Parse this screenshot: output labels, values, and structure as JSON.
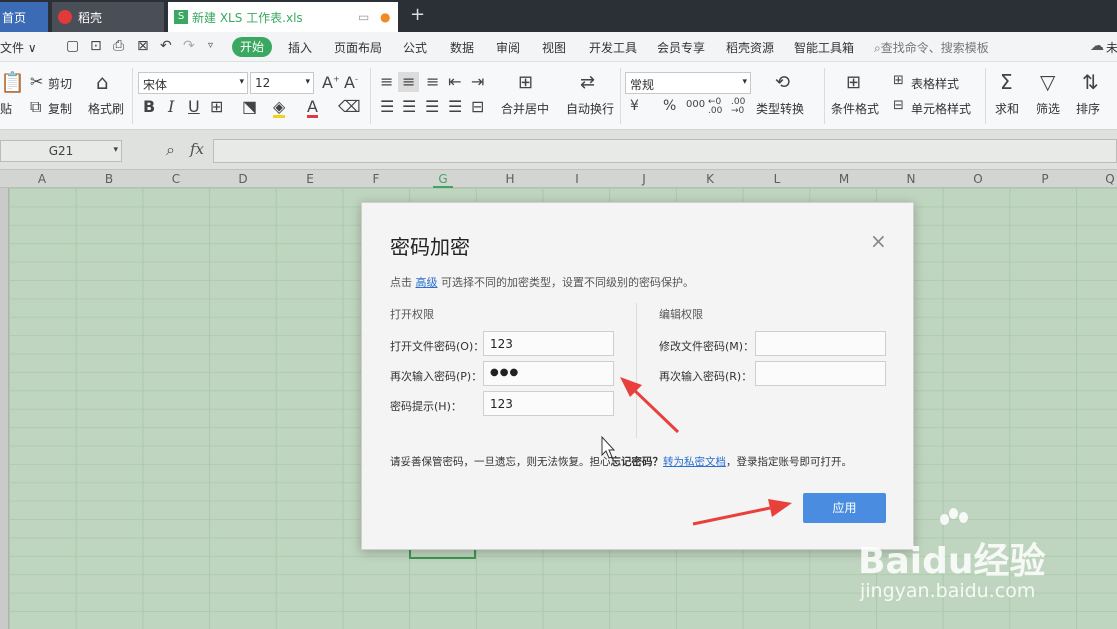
{
  "tabs": [
    {
      "label": "首页"
    },
    {
      "label": "稻壳"
    },
    {
      "label": "新建 XLS 工作表.xls"
    }
  ],
  "new_tab": "+",
  "menu": {
    "file": "文件",
    "start": "开始",
    "items": [
      "插入",
      "页面布局",
      "公式",
      "数据",
      "审阅",
      "视图",
      "开发工具",
      "会员专享",
      "稻壳资源",
      "智能工具箱"
    ],
    "search_placeholder": "查找命令、搜索模板",
    "right": "未"
  },
  "ribbon": {
    "cut": "剪切",
    "paste": "贴",
    "copy": "复制",
    "format_painter": "格式刷",
    "font": "宋体",
    "font_size": "12",
    "bold": "B",
    "italic": "I",
    "underline": "U",
    "merge": "合并居中",
    "wrap": "自动换行",
    "number_format": "常规",
    "currency": "¥",
    "percent": "%",
    "convert": "类型转换",
    "cond_format": "条件格式",
    "table_style": "表格样式",
    "cell_style": "单元格样式",
    "sum": "求和",
    "filter": "筛选",
    "sort": "排序"
  },
  "formula_bar": {
    "cell_ref": "G21",
    "fx": "fx"
  },
  "columns": [
    "A",
    "B",
    "C",
    "D",
    "E",
    "F",
    "G",
    "H",
    "I",
    "J",
    "K",
    "L",
    "M",
    "N",
    "O",
    "P",
    "Q"
  ],
  "dialog": {
    "title": "密码加密",
    "hint_prefix": "点击",
    "hint_link": "高级",
    "hint_suffix": "可选择不同的加密类型，设置不同级别的密码保护。",
    "open_section": "打开权限",
    "edit_section": "编辑权限",
    "open_pwd_label": "打开文件密码(O)：",
    "open_pwd_value": "123",
    "reenter_label": "再次输入密码(P)：",
    "reenter_value": "●●●",
    "hint_label": "密码提示(H)：",
    "hint_value": "123",
    "modify_pwd_label": "修改文件密码(M)：",
    "modify_reenter_label": "再次输入密码(R)：",
    "warning_prefix": "请妥善保管密码，一旦遗忘，则无法恢复。担心",
    "warning_bold": "忘记密码？",
    "warning_link": "转为私密文档",
    "warning_suffix": "，登录指定账号即可打开。",
    "apply": "应用"
  },
  "watermark": {
    "brand": "Baidu经验",
    "url": "jingyan.baidu.com"
  },
  "colors": {
    "accent": "#4a8de0",
    "start_tab": "#3aa860",
    "arrow": "#e8413c"
  }
}
